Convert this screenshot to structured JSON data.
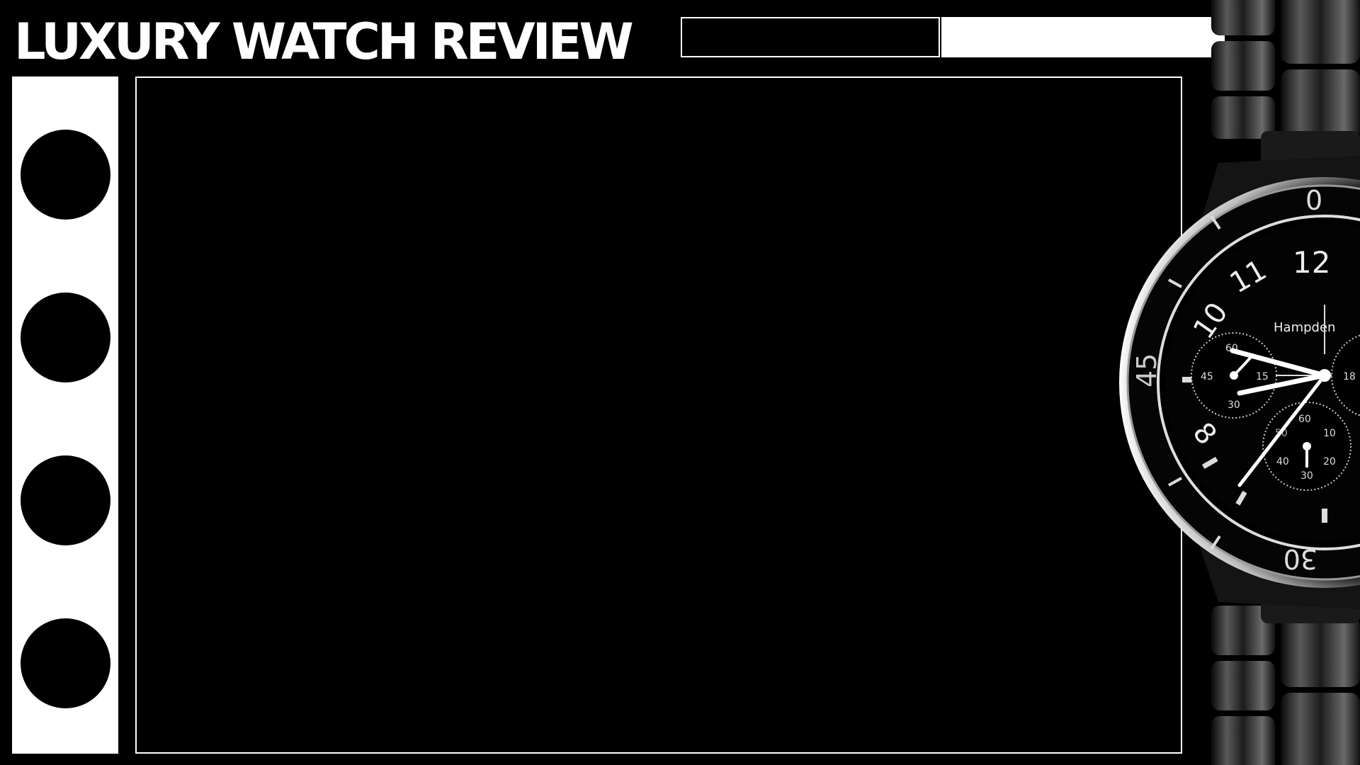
{
  "header": {
    "title": "LUXURY WATCH REVIEW"
  },
  "watch": {
    "brand": "Hampden",
    "bezel_numbers": [
      "0",
      "45",
      "30"
    ],
    "dial_numerals": [
      "12",
      "11",
      "10",
      "8"
    ],
    "subdial_left_labels": [
      "60",
      "15",
      "45",
      "30"
    ],
    "subdial_bottom_labels": [
      "60",
      "10",
      "50",
      "20",
      "40",
      "30"
    ],
    "subdial_right_labels": [
      "18"
    ]
  },
  "colors": {
    "background": "#000000",
    "foreground": "#ffffff"
  }
}
